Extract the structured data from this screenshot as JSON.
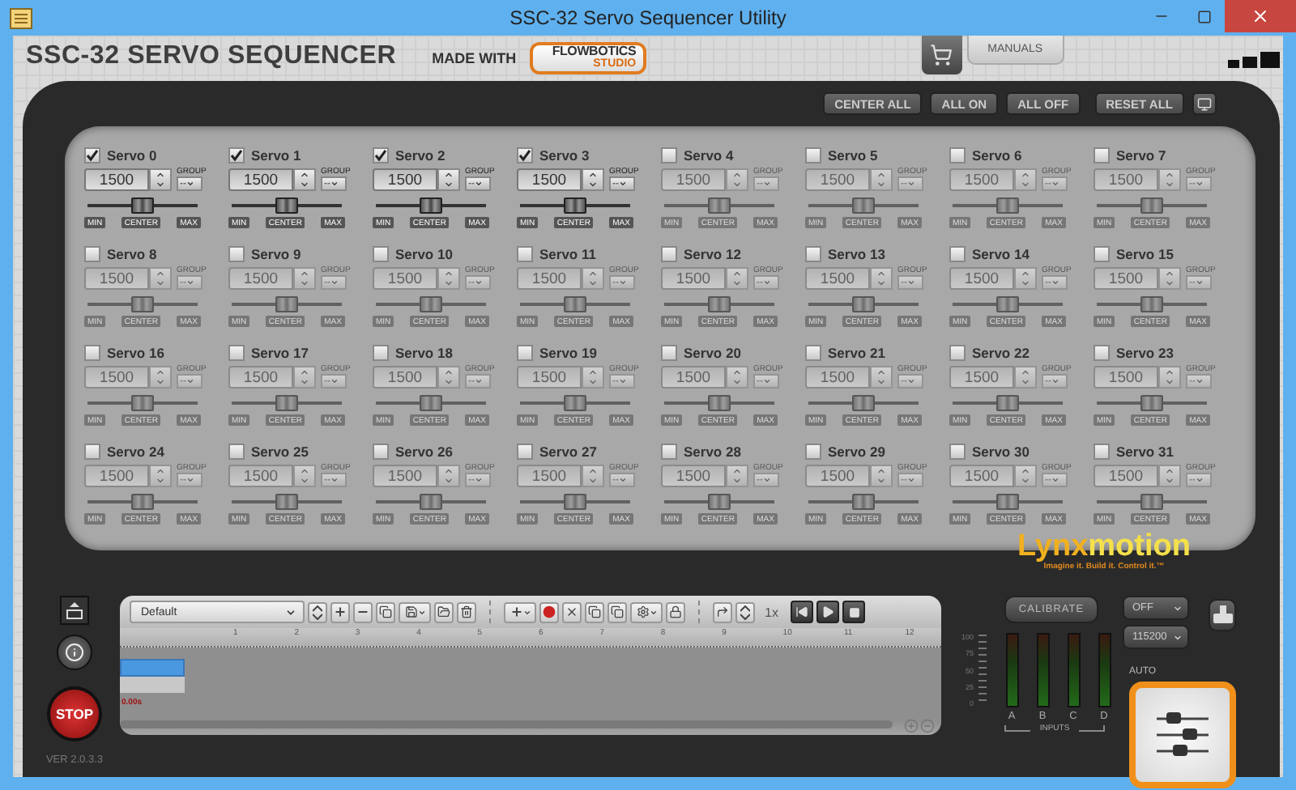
{
  "window": {
    "title": "SSC-32 Servo Sequencer Utility"
  },
  "header": {
    "app_name": "SSC-32 SERVO SEQUENCER",
    "made_with": "MADE WITH",
    "logo_top": "FLOWBOTICS",
    "logo_bottom": "STUDIO",
    "manuals_button": "MANUALS"
  },
  "toolbar": {
    "buttons": [
      "CENTER ALL",
      "ALL ON",
      "ALL OFF",
      "RESET ALL"
    ]
  },
  "servos": [
    {
      "label": "Servo 0",
      "checked": true,
      "value": "1500",
      "group_label": "GROUP",
      "group": "--",
      "level": 0.5,
      "buttons": [
        "MIN",
        "CENTER",
        "MAX"
      ]
    },
    {
      "label": "Servo 1",
      "checked": true,
      "value": "1500",
      "group_label": "GROUP",
      "group": "--",
      "level": 0.5,
      "buttons": [
        "MIN",
        "CENTER",
        "MAX"
      ]
    },
    {
      "label": "Servo 2",
      "checked": true,
      "value": "1500",
      "group_label": "GROUP",
      "group": "--",
      "level": 0.5,
      "buttons": [
        "MIN",
        "CENTER",
        "MAX"
      ]
    },
    {
      "label": "Servo 3",
      "checked": true,
      "value": "1500",
      "group_label": "GROUP",
      "group": "--",
      "level": 0.5,
      "buttons": [
        "MIN",
        "CENTER",
        "MAX"
      ]
    },
    {
      "label": "Servo 4",
      "checked": false,
      "value": "1500",
      "group_label": "GROUP",
      "group": "--",
      "level": 0.5,
      "buttons": [
        "MIN",
        "CENTER",
        "MAX"
      ]
    },
    {
      "label": "Servo 5",
      "checked": false,
      "value": "1500",
      "group_label": "GROUP",
      "group": "--",
      "level": 0.5,
      "buttons": [
        "MIN",
        "CENTER",
        "MAX"
      ]
    },
    {
      "label": "Servo 6",
      "checked": false,
      "value": "1500",
      "group_label": "GROUP",
      "group": "--",
      "level": 0.5,
      "buttons": [
        "MIN",
        "CENTER",
        "MAX"
      ]
    },
    {
      "label": "Servo 7",
      "checked": false,
      "value": "1500",
      "group_label": "GROUP",
      "group": "--",
      "level": 0.5,
      "buttons": [
        "MIN",
        "CENTER",
        "MAX"
      ]
    },
    {
      "label": "Servo 8",
      "checked": false,
      "value": "1500",
      "group_label": "GROUP",
      "group": "--",
      "level": 0.5,
      "buttons": [
        "MIN",
        "CENTER",
        "MAX"
      ]
    },
    {
      "label": "Servo 9",
      "checked": false,
      "value": "1500",
      "group_label": "GROUP",
      "group": "--",
      "level": 0.5,
      "buttons": [
        "MIN",
        "CENTER",
        "MAX"
      ]
    },
    {
      "label": "Servo 10",
      "checked": false,
      "value": "1500",
      "group_label": "GROUP",
      "group": "--",
      "level": 0.5,
      "buttons": [
        "MIN",
        "CENTER",
        "MAX"
      ]
    },
    {
      "label": "Servo 11",
      "checked": false,
      "value": "1500",
      "group_label": "GROUP",
      "group": "--",
      "level": 0.5,
      "buttons": [
        "MIN",
        "CENTER",
        "MAX"
      ]
    },
    {
      "label": "Servo 12",
      "checked": false,
      "value": "1500",
      "group_label": "GROUP",
      "group": "--",
      "level": 0.5,
      "buttons": [
        "MIN",
        "CENTER",
        "MAX"
      ]
    },
    {
      "label": "Servo 13",
      "checked": false,
      "value": "1500",
      "group_label": "GROUP",
      "group": "--",
      "level": 0.5,
      "buttons": [
        "MIN",
        "CENTER",
        "MAX"
      ]
    },
    {
      "label": "Servo 14",
      "checked": false,
      "value": "1500",
      "group_label": "GROUP",
      "group": "--",
      "level": 0.5,
      "buttons": [
        "MIN",
        "CENTER",
        "MAX"
      ]
    },
    {
      "label": "Servo 15",
      "checked": false,
      "value": "1500",
      "group_label": "GROUP",
      "group": "--",
      "level": 0.5,
      "buttons": [
        "MIN",
        "CENTER",
        "MAX"
      ]
    },
    {
      "label": "Servo 16",
      "checked": false,
      "value": "1500",
      "group_label": "GROUP",
      "group": "--",
      "level": 0.5,
      "buttons": [
        "MIN",
        "CENTER",
        "MAX"
      ]
    },
    {
      "label": "Servo 17",
      "checked": false,
      "value": "1500",
      "group_label": "GROUP",
      "group": "--",
      "level": 0.5,
      "buttons": [
        "MIN",
        "CENTER",
        "MAX"
      ]
    },
    {
      "label": "Servo 18",
      "checked": false,
      "value": "1500",
      "group_label": "GROUP",
      "group": "--",
      "level": 0.5,
      "buttons": [
        "MIN",
        "CENTER",
        "MAX"
      ]
    },
    {
      "label": "Servo 19",
      "checked": false,
      "value": "1500",
      "group_label": "GROUP",
      "group": "--",
      "level": 0.5,
      "buttons": [
        "MIN",
        "CENTER",
        "MAX"
      ]
    },
    {
      "label": "Servo 20",
      "checked": false,
      "value": "1500",
      "group_label": "GROUP",
      "group": "--",
      "level": 0.5,
      "buttons": [
        "MIN",
        "CENTER",
        "MAX"
      ]
    },
    {
      "label": "Servo 21",
      "checked": false,
      "value": "1500",
      "group_label": "GROUP",
      "group": "--",
      "level": 0.5,
      "buttons": [
        "MIN",
        "CENTER",
        "MAX"
      ]
    },
    {
      "label": "Servo 22",
      "checked": false,
      "value": "1500",
      "group_label": "GROUP",
      "group": "--",
      "level": 0.5,
      "buttons": [
        "MIN",
        "CENTER",
        "MAX"
      ]
    },
    {
      "label": "Servo 23",
      "checked": false,
      "value": "1500",
      "group_label": "GROUP",
      "group": "--",
      "level": 0.5,
      "buttons": [
        "MIN",
        "CENTER",
        "MAX"
      ]
    },
    {
      "label": "Servo 24",
      "checked": false,
      "value": "1500",
      "group_label": "GROUP",
      "group": "--",
      "level": 0.5,
      "buttons": [
        "MIN",
        "CENTER",
        "MAX"
      ]
    },
    {
      "label": "Servo 25",
      "checked": false,
      "value": "1500",
      "group_label": "GROUP",
      "group": "--",
      "level": 0.5,
      "buttons": [
        "MIN",
        "CENTER",
        "MAX"
      ]
    },
    {
      "label": "Servo 26",
      "checked": false,
      "value": "1500",
      "group_label": "GROUP",
      "group": "--",
      "level": 0.5,
      "buttons": [
        "MIN",
        "CENTER",
        "MAX"
      ]
    },
    {
      "label": "Servo 27",
      "checked": false,
      "value": "1500",
      "group_label": "GROUP",
      "group": "--",
      "level": 0.5,
      "buttons": [
        "MIN",
        "CENTER",
        "MAX"
      ]
    },
    {
      "label": "Servo 28",
      "checked": false,
      "value": "1500",
      "group_label": "GROUP",
      "group": "--",
      "level": 0.5,
      "buttons": [
        "MIN",
        "CENTER",
        "MAX"
      ]
    },
    {
      "label": "Servo 29",
      "checked": false,
      "value": "1500",
      "group_label": "GROUP",
      "group": "--",
      "level": 0.5,
      "buttons": [
        "MIN",
        "CENTER",
        "MAX"
      ]
    },
    {
      "label": "Servo 30",
      "checked": false,
      "value": "1500",
      "group_label": "GROUP",
      "group": "--",
      "level": 0.5,
      "buttons": [
        "MIN",
        "CENTER",
        "MAX"
      ]
    },
    {
      "label": "Servo 31",
      "checked": false,
      "value": "1500",
      "group_label": "GROUP",
      "group": "--",
      "level": 0.5,
      "buttons": [
        "MIN",
        "CENTER",
        "MAX"
      ]
    }
  ],
  "brand": {
    "name_a": "Lynx",
    "name_b": "motion",
    "tagline": "Imagine it. Build it. Control it.™"
  },
  "sequencer": {
    "preset": "Default",
    "speed": "1x",
    "ruler": [
      "1",
      "2",
      "3",
      "4",
      "5",
      "6",
      "7",
      "8",
      "9",
      "10",
      "11",
      "12"
    ],
    "time": "0.00s"
  },
  "controls": {
    "stop": "STOP",
    "version": "VER 2.0.3.3",
    "calibrate": "CALIBRATE",
    "port": "OFF",
    "baud": "115200",
    "auto": "AUTO"
  },
  "meters": {
    "scale": [
      "100",
      "75",
      "50",
      "25",
      "0"
    ],
    "channels": [
      "A",
      "B",
      "C",
      "D"
    ],
    "label": "INPUTS"
  }
}
